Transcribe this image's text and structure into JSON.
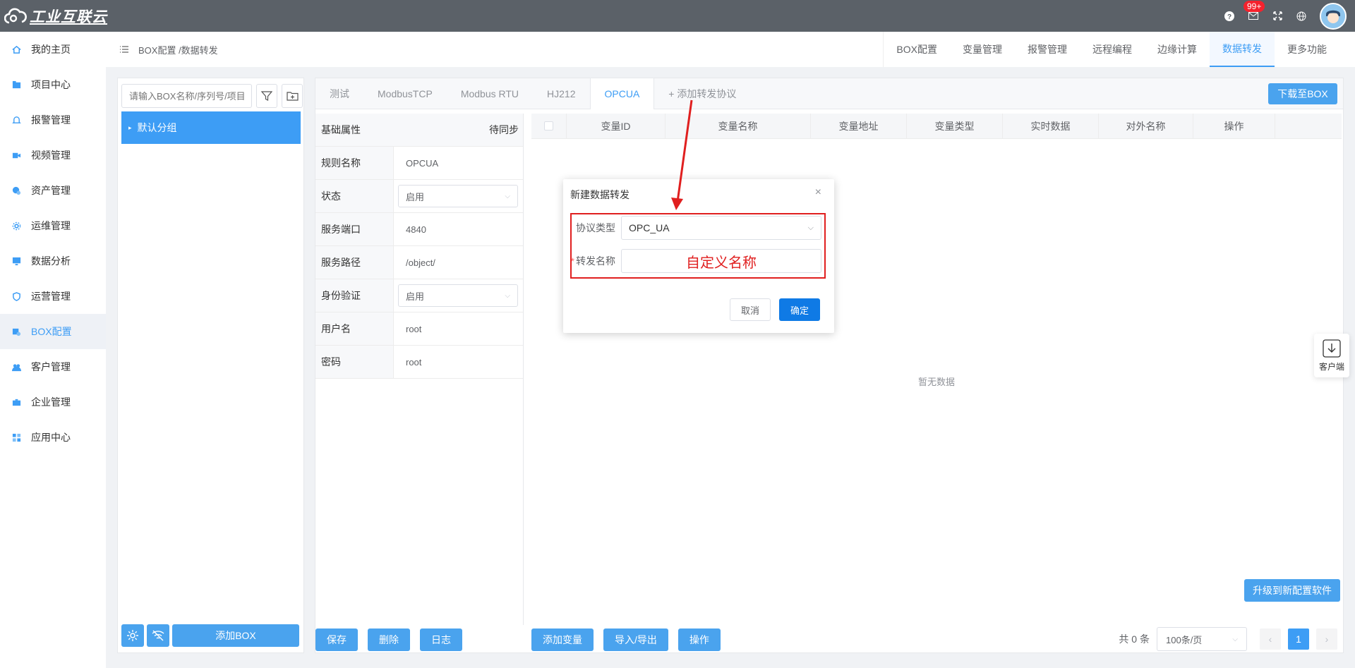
{
  "brand": {
    "logo_text": "工业互联云"
  },
  "topbar": {
    "badge": "99+"
  },
  "sidebar": {
    "items": [
      {
        "label": "我的主页",
        "icon": "home-icon"
      },
      {
        "label": "项目中心",
        "icon": "folder-icon"
      },
      {
        "label": "报警管理",
        "icon": "bell-icon"
      },
      {
        "label": "视频管理",
        "icon": "video-icon"
      },
      {
        "label": "资产管理",
        "icon": "asset-icon"
      },
      {
        "label": "运维管理",
        "icon": "gear-icon"
      },
      {
        "label": "数据分析",
        "icon": "monitor-icon"
      },
      {
        "label": "运营管理",
        "icon": "shield-icon"
      },
      {
        "label": "BOX配置",
        "icon": "box-config-icon",
        "active": true
      },
      {
        "label": "客户管理",
        "icon": "users-icon"
      },
      {
        "label": "企业管理",
        "icon": "briefcase-icon"
      },
      {
        "label": "应用中心",
        "icon": "apps-icon"
      }
    ]
  },
  "breadcrumb": "BOX配置 /数据转发",
  "top_tabs": [
    "BOX配置",
    "变量管理",
    "报警管理",
    "远程编程",
    "边缘计算",
    "数据转发",
    "更多功能"
  ],
  "top_tab_active": "数据转发",
  "left": {
    "search_placeholder": "请输入BOX名称/序列号/项目",
    "group": "默认分组",
    "add_box": "添加BOX"
  },
  "protocol_tabs": [
    "测试",
    "ModbusTCP",
    "Modbus RTU",
    "HJ212",
    "OPCUA",
    "+ 添加转发协议"
  ],
  "protocol_active": "OPCUA",
  "download_btn": "下载至BOX",
  "props": {
    "header_label": "基础属性",
    "header_status": "待同步",
    "rows": [
      {
        "label": "规则名称",
        "value": "OPCUA",
        "type": "text"
      },
      {
        "label": "状态",
        "value": "启用",
        "type": "select"
      },
      {
        "label": "服务端口",
        "value": "4840",
        "type": "text"
      },
      {
        "label": "服务路径",
        "value": "/object/",
        "type": "text"
      },
      {
        "label": "身份验证",
        "value": "启用",
        "type": "select"
      },
      {
        "label": "用户名",
        "value": "root",
        "type": "text"
      },
      {
        "label": "密码",
        "value": "root",
        "type": "text"
      }
    ]
  },
  "table": {
    "columns": [
      "变量ID",
      "变量名称",
      "变量地址",
      "变量类型",
      "实时数据",
      "对外名称",
      "操作"
    ],
    "empty": "暂无数据"
  },
  "upgrade_btn": "升级到新配置软件",
  "bottom_left": [
    "保存",
    "删除",
    "日志"
  ],
  "bottom_main": [
    "添加变量",
    "导入/导出",
    "操作"
  ],
  "pager": {
    "total": "共 0 条",
    "size": "100条/页",
    "page": "1"
  },
  "float": {
    "label": "客户端"
  },
  "modal": {
    "title": "新建数据转发",
    "protocol_label": "协议类型",
    "protocol_value": "OPC_UA",
    "name_label": "转发名称",
    "name_value": "自定义名称",
    "cancel": "取消",
    "ok": "确定"
  }
}
